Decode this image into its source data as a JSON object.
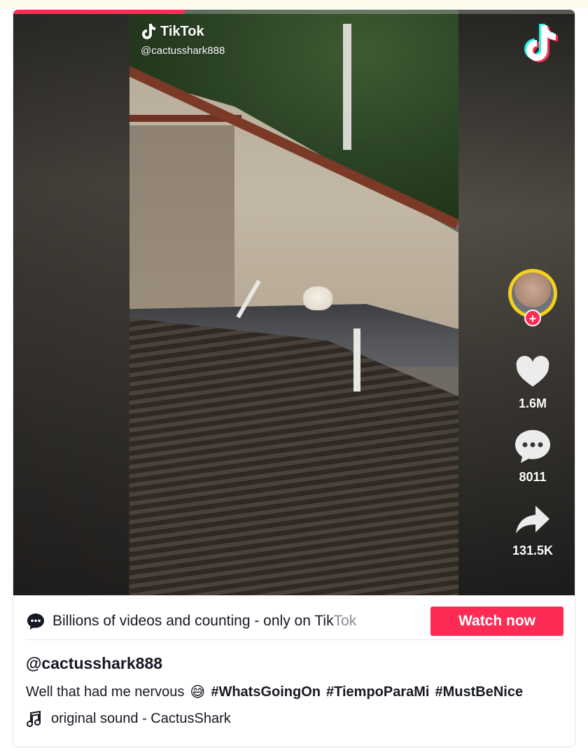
{
  "page": {
    "accent_color": "#fe2c55",
    "top_bar_color": "#fffbea"
  },
  "video": {
    "progress_fraction": 0.305,
    "watermark_brand": "TikTok",
    "watermark_handle": "@cactusshark888",
    "logo_icon": "tiktok-logo-icon"
  },
  "rail": {
    "avatar_icon": "avatar",
    "follow_symbol": "+",
    "likes": "1.6M",
    "comments": "8011",
    "shares": "131.5K",
    "like_icon": "heart-icon",
    "comment_icon": "comment-bubble-icon",
    "share_icon": "share-arrow-icon"
  },
  "promo": {
    "icon": "chat-bubble-icon",
    "text_main": "Billions of videos and counting - only on Tik",
    "text_fade": "Tok",
    "button_label": "Watch now"
  },
  "post": {
    "author": "@cactusshark888",
    "caption_text": "Well that had me nervous",
    "caption_emoji": "😅",
    "hashtags": [
      "#WhatsGoingOn",
      "#TiempoParaMi",
      "#MustBeNice"
    ],
    "sound_icon": "music-note-icon",
    "sound_label": "original sound - CactusShark"
  }
}
